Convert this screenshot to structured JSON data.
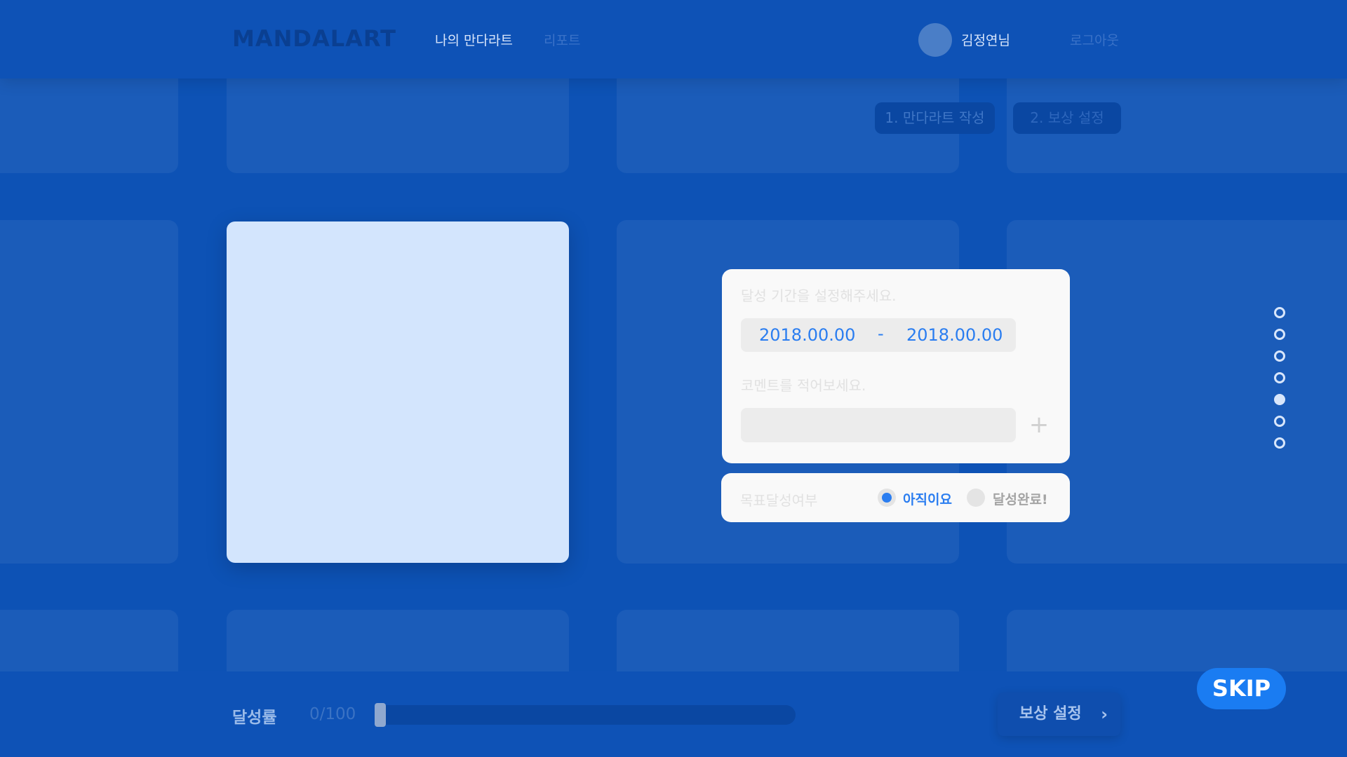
{
  "header": {
    "logo": "MANDALART",
    "nav": {
      "mine": "나의 만다라트",
      "report": "리포트"
    },
    "user_name": "김정연님",
    "logout": "로그아웃"
  },
  "steps": {
    "step1": "1. 만다라트 작성",
    "step2": "2. 보상 설정"
  },
  "panel": {
    "period_label": "달성 기간을 설정해주세요.",
    "date_start": "2018.00.00",
    "date_separator": "-",
    "date_end": "2018.00.00",
    "comment_label": "코멘트를 적어보세요.",
    "comment_value": "",
    "add_icon": "plus-icon"
  },
  "achievement": {
    "label": "목표달성여부",
    "option_yet": "아직이요",
    "option_done": "달성완료!",
    "selected": "아직이요"
  },
  "pager": {
    "count": 7,
    "active_index": 4
  },
  "footer": {
    "rate_label": "달성률",
    "rate_value": "0/100",
    "progress": 0,
    "reward_button": "보상 설정",
    "reward_arrow": "›"
  },
  "skip": "SKIP",
  "colors": {
    "background": "#0d52b5",
    "accent": "#2a7df0",
    "center_cell": "#d3e5fd",
    "panel": "#f9f9f9",
    "skip_button": "#1a7cf2"
  }
}
